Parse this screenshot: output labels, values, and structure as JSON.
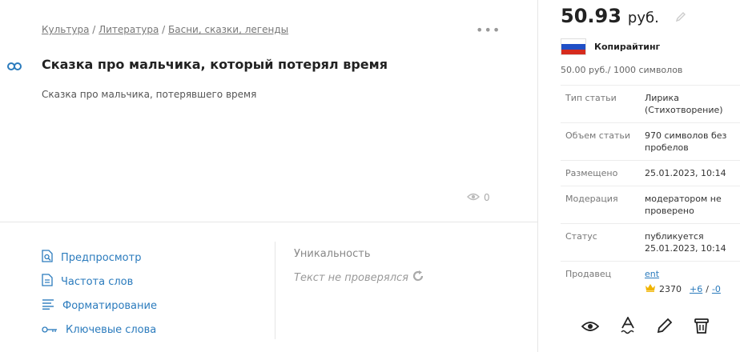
{
  "breadcrumb": {
    "items": [
      "Культура",
      "Литература",
      "Басни, сказки, легенды"
    ],
    "separator": " / "
  },
  "more_label": "•••",
  "article": {
    "title": "Сказка про мальчика, который потерял время",
    "subtitle": "Сказка про мальчика, потерявшего время",
    "views": "0"
  },
  "actions": [
    {
      "label": "Предпросмотр",
      "icon": "preview-icon"
    },
    {
      "label": "Частота слов",
      "icon": "document-icon"
    },
    {
      "label": "Форматирование",
      "icon": "format-icon"
    },
    {
      "label": "Ключевые слова",
      "icon": "key-icon"
    }
  ],
  "uniqueness": {
    "label": "Уникальность",
    "status": "Текст не проверялся"
  },
  "price": {
    "value": "50.93",
    "unit": "руб."
  },
  "tariff": "Копирайтинг",
  "rate": "50.00 руб./ 1000 символов",
  "info": [
    {
      "key": "Тип статьи",
      "value": "Лирика (Стихотворение)"
    },
    {
      "key": "Объем статьи",
      "value": "970 символов без пробелов"
    },
    {
      "key": "Размещено",
      "value": "25.01.2023, 10:14"
    },
    {
      "key": "Модерация",
      "value": "модератором не проверено"
    },
    {
      "key": "Статус",
      "value": "публикуется 25.01.2023, 10:14"
    }
  ],
  "seller": {
    "key": "Продавец",
    "name": "ent",
    "rating": "2370",
    "plus": "+6",
    "sep": "/",
    "minus": "-0"
  },
  "colors": {
    "link": "#2b7bbd",
    "plus": "#2e9e3e",
    "minus": "#d33"
  }
}
